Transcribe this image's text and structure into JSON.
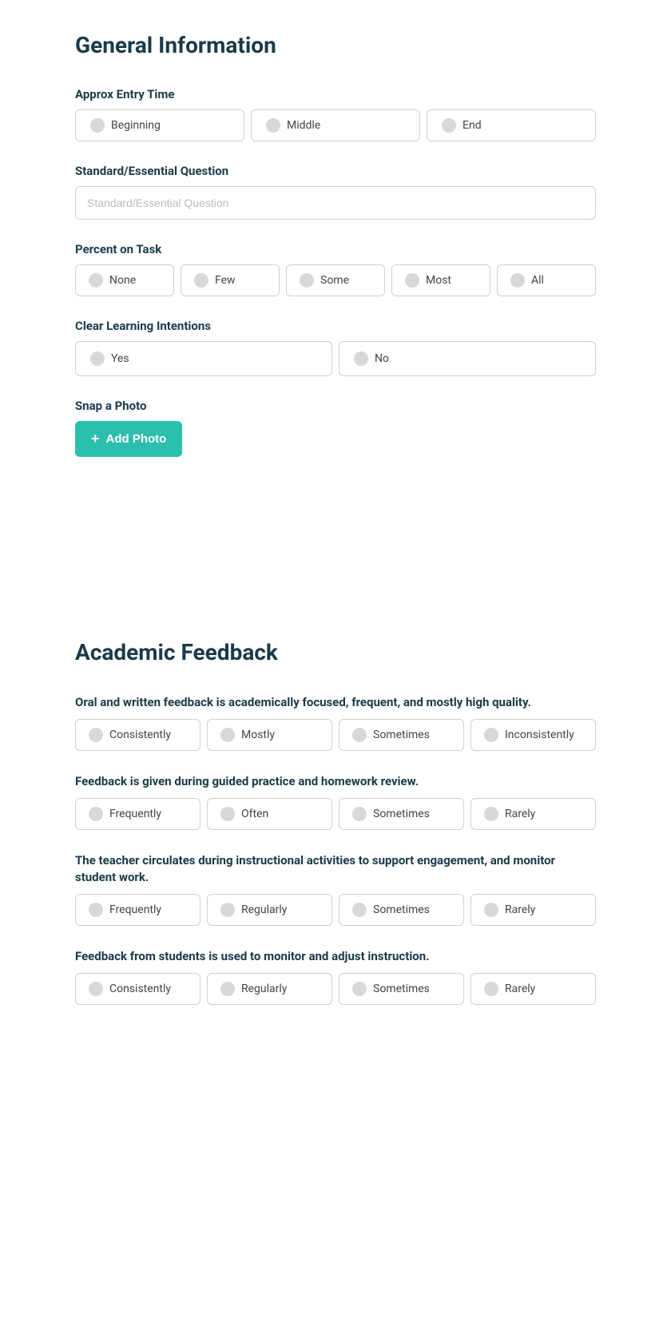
{
  "general_section": {
    "title": "General Information",
    "entry_time": {
      "label": "Approx Entry Time",
      "options": [
        "Beginning",
        "Middle",
        "End"
      ]
    },
    "standard_question": {
      "label": "Standard/Essential Question",
      "placeholder": "Standard/Essential Question"
    },
    "percent_on_task": {
      "label": "Percent on Task",
      "options": [
        "None",
        "Few",
        "Some",
        "Most",
        "All"
      ]
    },
    "clear_learning": {
      "label": "Clear Learning Intentions",
      "options": [
        "Yes",
        "No"
      ]
    },
    "snap_photo": {
      "label": "Snap a Photo",
      "button": "Add Photo"
    }
  },
  "academic_section": {
    "title": "Academic Feedback",
    "questions": [
      {
        "id": "q1",
        "text": "Oral and written feedback is academically focused, frequent, and mostly high quality.",
        "options": [
          "Consistently",
          "Mostly",
          "Sometimes",
          "Inconsistently"
        ]
      },
      {
        "id": "q2",
        "text": "Feedback is given during guided practice and homework review.",
        "options": [
          "Frequently",
          "Often",
          "Sometimes",
          "Rarely"
        ]
      },
      {
        "id": "q3",
        "text": "The teacher circulates during instructional activities to support engagement, and monitor student work.",
        "options": [
          "Frequently",
          "Regularly",
          "Sometimes",
          "Rarely"
        ]
      },
      {
        "id": "q4",
        "text": "Feedback from students is used to monitor and adjust instruction.",
        "options": [
          "Consistently",
          "Regularly",
          "Sometimes",
          "Rarely"
        ]
      }
    ]
  }
}
